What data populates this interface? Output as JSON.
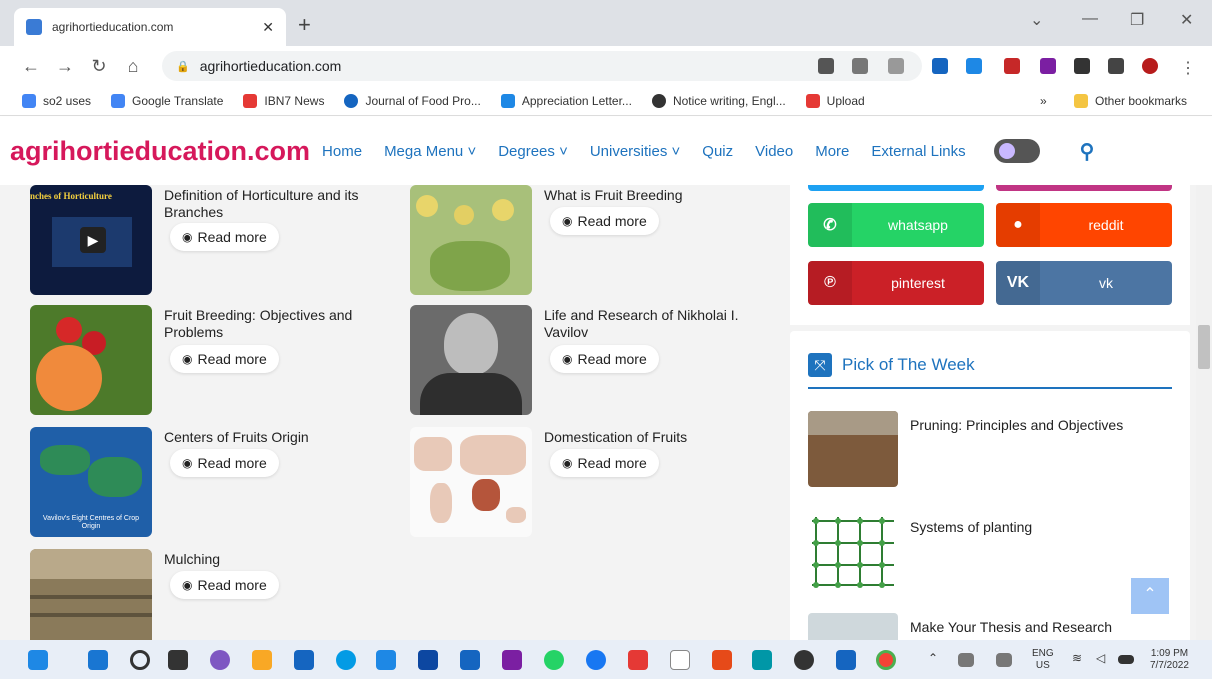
{
  "browser": {
    "tab_title": "agrihortieducation.com",
    "tab_close": "✕",
    "new_tab": "+",
    "url": "agrihortieducation.com",
    "bookmarks": [
      {
        "label": "so2 uses",
        "color": "#4285f4"
      },
      {
        "label": "Google Translate",
        "color": "#4285f4"
      },
      {
        "label": "IBN7 News",
        "color": "#e53935"
      },
      {
        "label": "Journal of Food Pro...",
        "color": "#1565c0"
      },
      {
        "label": "Appreciation Letter...",
        "color": "#1e88e5"
      },
      {
        "label": "Notice writing, Engl...",
        "color": "#333333"
      },
      {
        "label": "Upload",
        "color": "#e53935"
      }
    ],
    "more_bookmarks": "»",
    "other_bookmarks": "Other bookmarks"
  },
  "site": {
    "logo": "agrihortieducation.com",
    "menu": [
      "Home",
      "Mega Menu ˅",
      "Degrees ˅",
      "Universities ˅",
      "Quiz",
      "Video",
      "More",
      "External Links"
    ]
  },
  "articles": [
    {
      "title": "Definition of Horticulture and its Branches",
      "read_more": "Read more",
      "thumb_caption": "nches of Horticulture"
    },
    {
      "title": "What is Fruit Breeding",
      "read_more": "Read more"
    },
    {
      "title": "Fruit Breeding: Objectives and Problems",
      "read_more": "Read more"
    },
    {
      "title": "Life and Research of Nikholai I. Vavilov",
      "read_more": "Read more"
    },
    {
      "title": "Centers of Fruits Origin",
      "read_more": "Read more",
      "thumb_caption": "Vavilov's Eight Centres of Crop Origin"
    },
    {
      "title": "Domestication of Fruits",
      "read_more": "Read more"
    },
    {
      "title": "Mulching",
      "read_more": "Read more"
    }
  ],
  "social": [
    {
      "label": "whatsapp",
      "color": "#25d366"
    },
    {
      "label": "reddit",
      "color": "#ff4500"
    },
    {
      "label": "pinterest",
      "color": "#cb2027"
    },
    {
      "label": "vk",
      "color": "#4c75a3"
    }
  ],
  "pick_of_week": {
    "heading": "Pick of The Week",
    "items": [
      {
        "title": "Pruning: Principles and Objectives"
      },
      {
        "title": "Systems of planting"
      },
      {
        "title": "Make Your Thesis and Research"
      }
    ]
  },
  "taskbar": {
    "lang_line1": "ENG",
    "lang_line2": "US",
    "time": "1:09 PM",
    "date": "7/7/2022"
  }
}
